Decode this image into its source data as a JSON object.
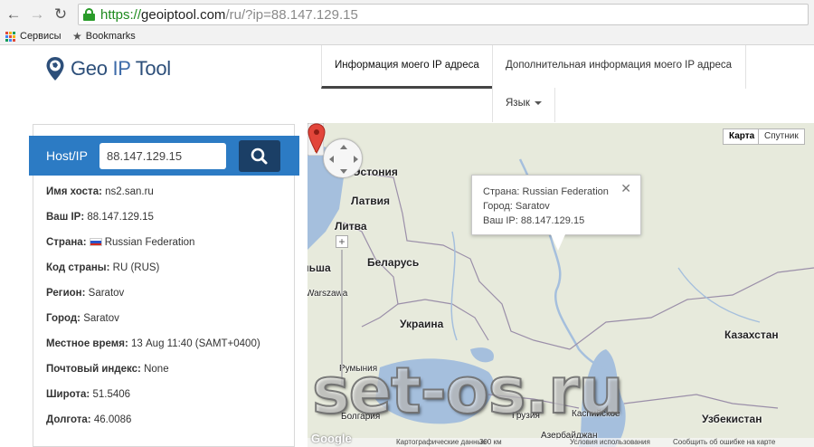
{
  "browser": {
    "url_scheme": "https://",
    "url_host": "geoiptool.com",
    "url_path": "/ru/?ip=88.147.129.15",
    "bookmarks": [
      {
        "label": "Сервисы",
        "icon": "apps-grid-icon"
      },
      {
        "label": "Bookmarks",
        "icon": "star-icon"
      }
    ]
  },
  "site": {
    "logo_geo": "Geo",
    "logo_ip": "IP",
    "logo_tool": "Tool",
    "nav": {
      "tab_my_ip": "Информация моего IP адреса",
      "tab_extra": "Дополнительная информация моего IP адреса",
      "tab_language": "Язык"
    }
  },
  "lookup": {
    "host_label": "Host/IP",
    "host_value": "88.147.129.15"
  },
  "info": [
    {
      "key": "Имя хоста:",
      "value": "ns2.san.ru"
    },
    {
      "key": "Ваш IP:",
      "value": "88.147.129.15"
    },
    {
      "key": "Страна:",
      "value": "Russian Federation",
      "flag": true
    },
    {
      "key": "Код страны:",
      "value": "RU (RUS)"
    },
    {
      "key": "Регион:",
      "value": "Saratov"
    },
    {
      "key": "Город:",
      "value": "Saratov"
    },
    {
      "key": "Местное время:",
      "value": "13 Aug 11:40 (SAMT+0400)"
    },
    {
      "key": "Почтовый индекс:",
      "value": "None"
    },
    {
      "key": "Широта:",
      "value": "51.5406"
    },
    {
      "key": "Долгота:",
      "value": "46.0086"
    }
  ],
  "map": {
    "type_map": "Карта",
    "type_satellite": "Спутник",
    "infowindow": {
      "line1": "Страна: Russian Federation",
      "line2": "Город: Saratov",
      "line3": "Ваш IP: 88.147.129.15"
    },
    "labels": {
      "estonia": "Эстония",
      "latvia": "Латвия",
      "lithuania": "Литва",
      "belarus": "Беларусь",
      "poland": "льша",
      "warsaw": "Warszawa",
      "ukraine": "Украина",
      "kazakhstan": "Казахстан",
      "romania": "Румыния",
      "bulgaria": "Болгария",
      "georgia": "Грузия",
      "azerbaijan": "Азербайджан",
      "uzbekistan": "Узбекистан",
      "caspian": "Каспийское"
    },
    "footer": {
      "mapdata": "Картографические данные",
      "scale": "300 км",
      "terms": "Условия использования",
      "report": "Сообщить об ошибке на карте"
    },
    "colors": {
      "land": "#e7eadc",
      "water": "#a5bfdd",
      "marker": "#e2453a"
    }
  },
  "watermark": "set-os.ru"
}
